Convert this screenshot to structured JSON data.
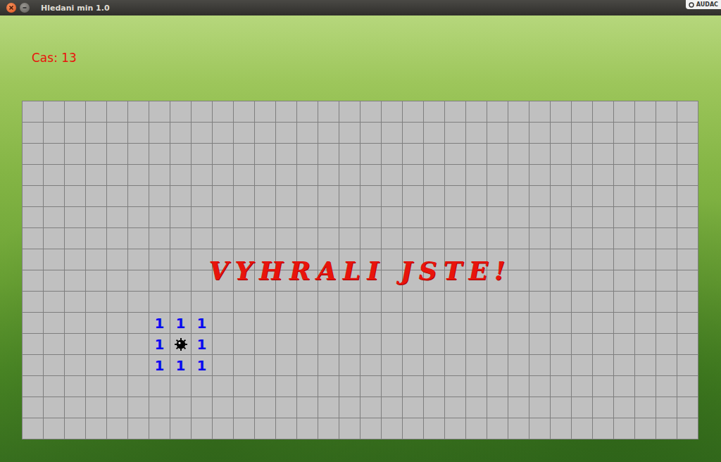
{
  "window": {
    "title": "Hledani min 1.0",
    "badge": "AUDAC"
  },
  "timer": "Cas: 13",
  "message": "VYHRALI JSTE!",
  "board": {
    "rows": [
      [
        "",
        "",
        "",
        "",
        "",
        "",
        "",
        "",
        "",
        "",
        "",
        "",
        "",
        "",
        "",
        "",
        "",
        "",
        "",
        "",
        "",
        "",
        "",
        "",
        "",
        "",
        "",
        "",
        "",
        "",
        "",
        ""
      ],
      [
        "",
        "",
        "",
        "",
        "",
        "",
        "",
        "",
        "",
        "",
        "",
        "",
        "",
        "",
        "",
        "",
        "",
        "",
        "",
        "",
        "",
        "",
        "",
        "",
        "",
        "",
        "",
        "",
        "",
        "",
        "",
        ""
      ],
      [
        "",
        "",
        "",
        "",
        "",
        "",
        "",
        "",
        "",
        "",
        "",
        "",
        "",
        "",
        "",
        "",
        "",
        "",
        "",
        "",
        "",
        "",
        "",
        "",
        "",
        "",
        "",
        "",
        "",
        "",
        "",
        ""
      ],
      [
        "",
        "",
        "",
        "",
        "",
        "",
        "",
        "",
        "",
        "",
        "",
        "",
        "",
        "",
        "",
        "",
        "",
        "",
        "",
        "",
        "",
        "",
        "",
        "",
        "",
        "",
        "",
        "",
        "",
        "",
        "",
        ""
      ],
      [
        "",
        "",
        "",
        "",
        "",
        "",
        "",
        "",
        "",
        "",
        "",
        "",
        "",
        "",
        "",
        "",
        "",
        "",
        "",
        "",
        "",
        "",
        "",
        "",
        "",
        "",
        "",
        "",
        "",
        "",
        "",
        ""
      ],
      [
        "",
        "",
        "",
        "",
        "",
        "",
        "",
        "",
        "",
        "",
        "",
        "",
        "",
        "",
        "",
        "",
        "",
        "",
        "",
        "",
        "",
        "",
        "",
        "",
        "",
        "",
        "",
        "",
        "",
        "",
        "",
        ""
      ],
      [
        "",
        "",
        "",
        "",
        "",
        "",
        "",
        "",
        "",
        "",
        "",
        "",
        "",
        "",
        "",
        "",
        "",
        "",
        "",
        "",
        "",
        "",
        "",
        "",
        "",
        "",
        "",
        "",
        "",
        "",
        "",
        ""
      ],
      [
        "",
        "",
        "",
        "",
        "",
        "",
        "",
        "",
        "",
        "",
        "",
        "",
        "",
        "",
        "",
        "",
        "",
        "",
        "",
        "",
        "",
        "",
        "",
        "",
        "",
        "",
        "",
        "",
        "",
        "",
        "",
        ""
      ],
      [
        "",
        "",
        "",
        "",
        "",
        "",
        "",
        "",
        "",
        "",
        "",
        "",
        "",
        "",
        "",
        "",
        "",
        "",
        "",
        "",
        "",
        "",
        "",
        "",
        "",
        "",
        "",
        "",
        "",
        "",
        "",
        ""
      ],
      [
        "",
        "",
        "",
        "",
        "",
        "",
        "",
        "",
        "",
        "",
        "",
        "",
        "",
        "",
        "",
        "",
        "",
        "",
        "",
        "",
        "",
        "",
        "",
        "",
        "",
        "",
        "",
        "",
        "",
        "",
        "",
        ""
      ],
      [
        "",
        "",
        "",
        "",
        "",
        "",
        "1",
        "1",
        "1",
        "",
        "",
        "",
        "",
        "",
        "",
        "",
        "",
        "",
        "",
        "",
        "",
        "",
        "",
        "",
        "",
        "",
        "",
        "",
        "",
        "",
        "",
        ""
      ],
      [
        "",
        "",
        "",
        "",
        "",
        "",
        "1",
        {
          "kind": "mine"
        },
        "1",
        "",
        "",
        "",
        "",
        "",
        "",
        "",
        "",
        "",
        "",
        "",
        "",
        "",
        "",
        "",
        "",
        "",
        "",
        "",
        "",
        "",
        "",
        ""
      ],
      [
        "",
        "",
        "",
        "",
        "",
        "",
        "1",
        "1",
        "1",
        "",
        "",
        "",
        "",
        "",
        "",
        "",
        "",
        "",
        "",
        "",
        "",
        "",
        "",
        "",
        "",
        "",
        "",
        "",
        "",
        "",
        "",
        ""
      ],
      [
        "",
        "",
        "",
        "",
        "",
        "",
        "",
        "",
        "",
        "",
        "",
        "",
        "",
        "",
        "",
        "",
        "",
        "",
        "",
        "",
        "",
        "",
        "",
        "",
        "",
        "",
        "",
        "",
        "",
        "",
        "",
        ""
      ],
      [
        "",
        "",
        "",
        "",
        "",
        "",
        "",
        "",
        "",
        "",
        "",
        "",
        "",
        "",
        "",
        "",
        "",
        "",
        "",
        "",
        "",
        "",
        "",
        "",
        "",
        "",
        "",
        "",
        "",
        "",
        "",
        ""
      ],
      [
        "",
        "",
        "",
        "",
        "",
        "",
        "",
        "",
        "",
        "",
        "",
        "",
        "",
        "",
        "",
        "",
        "",
        "",
        "",
        "",
        "",
        "",
        "",
        "",
        "",
        "",
        "",
        "",
        "",
        "",
        "",
        ""
      ]
    ]
  }
}
